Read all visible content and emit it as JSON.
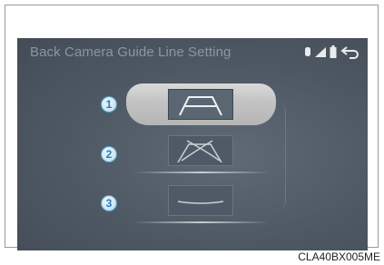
{
  "screen": {
    "title": "Back Camera Guide Line Setting"
  },
  "status_icons": [
    "bluetooth-icon",
    "signal-icon",
    "battery-icon",
    "back-arrow-icon"
  ],
  "options": [
    {
      "number": "1",
      "name": "Fixed guide lines",
      "selected": true
    },
    {
      "number": "2",
      "name": "Estimated course lines",
      "selected": false
    },
    {
      "number": "3",
      "name": "Distance guide lines",
      "selected": false
    }
  ],
  "figure_code": "CLA40BX005ME",
  "colors": {
    "screen_bg": "#4e5863",
    "title": "#8a96a2",
    "badge": "#2a7bb0"
  }
}
